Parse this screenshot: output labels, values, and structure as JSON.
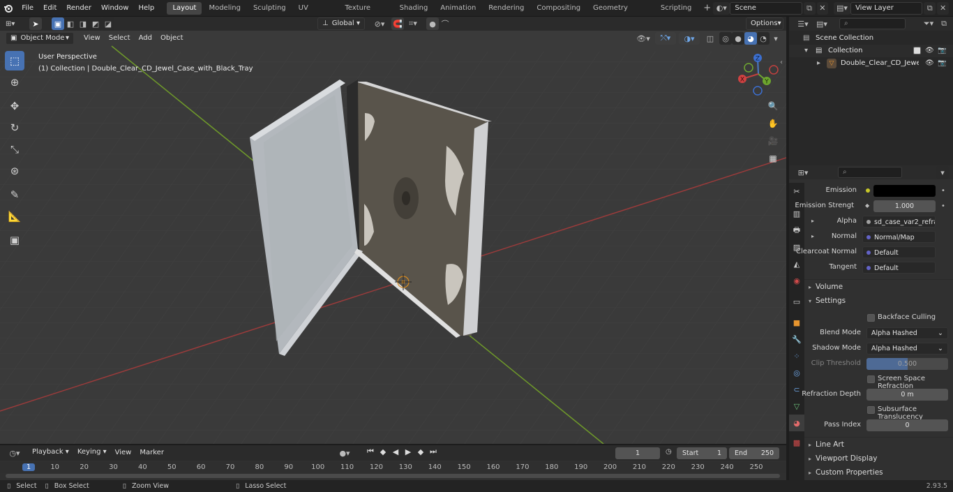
{
  "topbar": {
    "menus": [
      "File",
      "Edit",
      "Render",
      "Window",
      "Help"
    ],
    "workspaces": [
      "Layout",
      "Modeling",
      "Sculpting",
      "UV Editing",
      "Texture Paint",
      "Shading",
      "Animation",
      "Rendering",
      "Compositing",
      "Geometry Nodes",
      "Scripting"
    ],
    "active_workspace": "Layout",
    "scene": "Scene",
    "view_layer": "View Layer"
  },
  "viewport": {
    "mode": "Object Mode",
    "menus": [
      "View",
      "Select",
      "Add",
      "Object"
    ],
    "orientation": "Global",
    "options_label": "Options",
    "perspective": "User Perspective",
    "object_info": "(1) Collection | Double_Clear_CD_Jewel_Case_with_Black_Tray",
    "gizmo": {
      "x": "X",
      "y": "Y",
      "z": "Z"
    }
  },
  "outliner": {
    "scene_collection": "Scene Collection",
    "collection": "Collection",
    "object": "Double_Clear_CD_Jewel_"
  },
  "properties": {
    "emission": {
      "label": "Emission",
      "color": "#000000"
    },
    "emission_strength": {
      "label": "Emission Strengt",
      "value": "1.000"
    },
    "alpha": {
      "label": "Alpha",
      "value": "sd_case_var2_refrac..."
    },
    "normal": {
      "label": "Normal",
      "value": "Normal/Map"
    },
    "clearcoat_normal": {
      "label": "Clearcoat Normal",
      "value": "Default"
    },
    "tangent": {
      "label": "Tangent",
      "value": "Default"
    },
    "volume_section": "Volume",
    "settings_section": "Settings",
    "backface_culling": "Backface Culling",
    "blend_mode": {
      "label": "Blend Mode",
      "value": "Alpha Hashed"
    },
    "shadow_mode": {
      "label": "Shadow Mode",
      "value": "Alpha Hashed"
    },
    "clip_threshold": {
      "label": "Clip Threshold",
      "value": "0.500",
      "fraction": 0.5
    },
    "screen_space_refraction": "Screen Space Refraction",
    "refraction_depth": {
      "label": "Refraction Depth",
      "value": "0 m"
    },
    "subsurface_translucency": "Subsurface Translucency",
    "pass_index": {
      "label": "Pass Index",
      "value": "0"
    },
    "line_art_section": "Line Art",
    "viewport_display_section": "Viewport Display",
    "custom_properties_section": "Custom Properties"
  },
  "timeline": {
    "menus": [
      "Playback",
      "Keying",
      "View",
      "Marker"
    ],
    "current_frame": "1",
    "start_label": "Start",
    "start": "1",
    "end_label": "End",
    "end": "250",
    "ruler": [
      "1",
      "10",
      "20",
      "30",
      "40",
      "50",
      "60",
      "70",
      "80",
      "90",
      "100",
      "110",
      "120",
      "130",
      "140",
      "150",
      "160",
      "170",
      "180",
      "190",
      "200",
      "210",
      "220",
      "230",
      "240",
      "250"
    ]
  },
  "statusbar": {
    "select": "Select",
    "box_select": "Box Select",
    "zoom_view": "Zoom View",
    "lasso_select": "Lasso Select",
    "version": "2.93.5"
  }
}
